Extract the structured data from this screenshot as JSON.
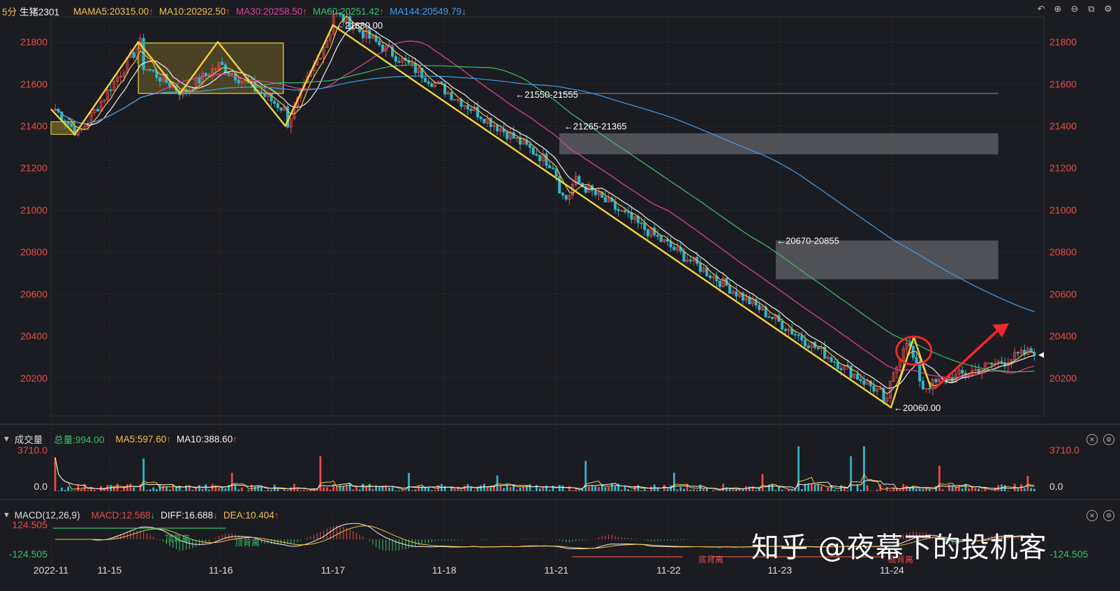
{
  "header": {
    "period": "5分",
    "symbol": "生猪2301",
    "ma_label": "MA",
    "ma": [
      {
        "text": "MA5:20315.00",
        "dir": "↑",
        "color": "#f5c24b"
      },
      {
        "text": "MA10:20292.50",
        "dir": "↑",
        "color": "#f0f0f0"
      },
      {
        "text": "MA30:20258.50",
        "dir": "↑",
        "color": "#e0409a"
      },
      {
        "text": "MA60:20251.42",
        "dir": "↑",
        "color": "#3ac16b"
      },
      {
        "text": "MA144:20549.79",
        "dir": "↓",
        "color": "#3d9cf0"
      }
    ]
  },
  "volume_header": {
    "title": "成交量",
    "total": "总量:994.00",
    "ma5": "MA5:597.60",
    "ma5_dir": "↑",
    "ma10": "MA10:388.60",
    "ma10_dir": "↑"
  },
  "macd_header": {
    "title": "MACD(12,26,9)",
    "macd": "MACD:12.568",
    "macd_dir": "↓",
    "diff": "DIFF:16.688",
    "diff_dir": "↓",
    "dea": "DEA:10.404",
    "dea_dir": "↑"
  },
  "watermark": "知乎 @夜幕下的投机客",
  "colors": {
    "up": "#e84a4a",
    "down": "#32b3c4",
    "ma5": "#f5c24b",
    "ma10": "#f0f0f0",
    "ma30": "#e0409a",
    "ma60": "#3ac16b",
    "ma144": "#3d9cf0",
    "drawing": "#f5d33a",
    "arrow": "#ee2a2a"
  },
  "chart_data": {
    "type": "candlestick",
    "y_ticks": [
      20200,
      20400,
      20600,
      20800,
      21000,
      21200,
      21400,
      21600,
      21800
    ],
    "ylim": [
      20020,
      21900
    ],
    "x_ticks": [
      "2022-11",
      "11-15",
      "11-16",
      "11-17",
      "11-18",
      "11-21",
      "11-22",
      "11-23",
      "11-24"
    ],
    "x_range": [
      0,
      100
    ],
    "x_tick_positions": [
      0,
      5.9,
      17.1,
      28.4,
      39.6,
      50.9,
      62.2,
      73.4,
      84.7
    ],
    "annotations": [
      {
        "text": "21880.00",
        "x": 28.4,
        "y": 21880
      },
      {
        "text": "21550-21555",
        "x": 46.5,
        "y": 21552
      },
      {
        "text": "21265-21365",
        "x": 51.4,
        "y": 21400
      },
      {
        "text": "20670-20855",
        "x": 72.8,
        "y": 20855
      },
      {
        "text": "20060.00",
        "x": 84.6,
        "y": 20060
      }
    ],
    "zones": [
      {
        "label": "21265-21365",
        "x0": 51.2,
        "x1": 95.4,
        "y0": 21265,
        "y1": 21365
      },
      {
        "label": "20670-20855",
        "x0": 73.0,
        "x1": 95.4,
        "y0": 20670,
        "y1": 20855
      }
    ],
    "yellow_box": {
      "x0": 8.8,
      "x1": 23.4,
      "y0": 21555,
      "y1": 21795
    },
    "resistance_line": {
      "x0": 51.2,
      "x1": 95.4,
      "y": 21555
    },
    "zigzag": [
      [
        0,
        21480
      ],
      [
        2.4,
        21360
      ],
      [
        8.8,
        21800
      ],
      [
        13.0,
        21555
      ],
      [
        16.8,
        21800
      ],
      [
        23.6,
        21400
      ],
      [
        28.4,
        21880
      ],
      [
        84.6,
        20060
      ],
      [
        86.9,
        20395
      ],
      [
        88.6,
        20155
      ]
    ],
    "trend_arrow": [
      [
        89.0,
        20150
      ],
      [
        96.5,
        20460
      ]
    ],
    "volume": {
      "ymax": 3710.0,
      "ymin": 0.0,
      "ticks": [
        "3710.0",
        "0.0"
      ]
    },
    "macd": {
      "ymax": 124.505,
      "ymin": -124.505,
      "ticks": [
        "124.505",
        "-124.505"
      ],
      "labels": [
        "顶背离",
        "顶背离",
        "底背离",
        "底背离"
      ]
    }
  }
}
